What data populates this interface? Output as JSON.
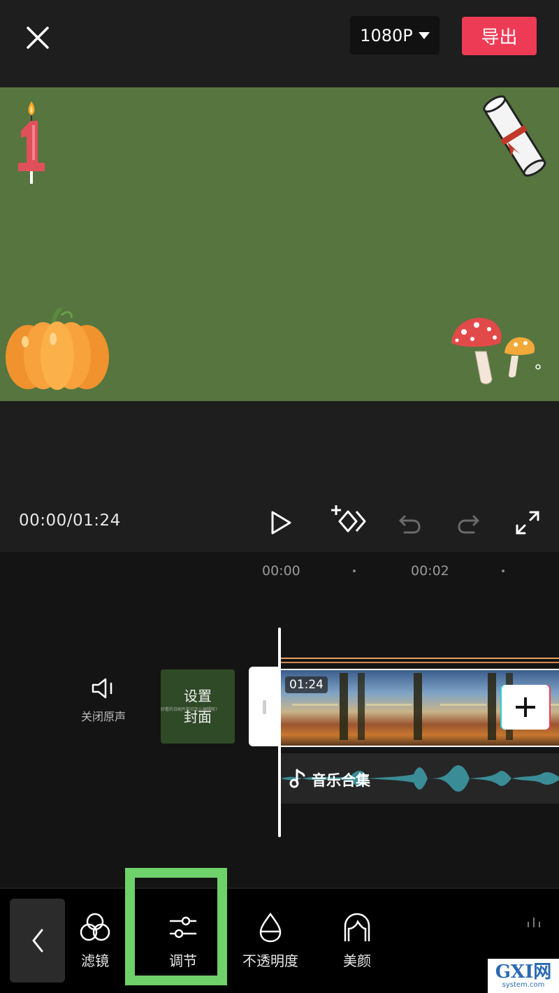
{
  "header": {
    "resolution_label": "1080P",
    "export_label": "导出",
    "accent_color": "#ee3b55"
  },
  "preview": {
    "background_color": "#56753f",
    "stickers": [
      "candle-number-1-sticker",
      "scroll-sticker",
      "pumpkin-sticker",
      "mushroom-sticker"
    ]
  },
  "playback": {
    "time_display": "00:00/01:24",
    "controls": [
      "play-icon",
      "keyframe-icon",
      "undo-icon",
      "redo-icon",
      "fullscreen-icon"
    ]
  },
  "timeline": {
    "ruler": [
      "00:00",
      "00:02"
    ],
    "mute_label": "关闭原声",
    "cover_label_line1": "设置",
    "cover_label_line2": "封面",
    "cover_tiny_text": "好看的日剧片剪切怎么编辑呢?",
    "clip_duration": "01:24",
    "audio_label": "音乐合集",
    "audio_color": "#3a8c96"
  },
  "toolbar": {
    "items": [
      {
        "label": "滤镜",
        "icon": "filter-icon"
      },
      {
        "label": "调节",
        "icon": "adjust-sliders-icon"
      },
      {
        "label": "不透明度",
        "icon": "opacity-drop-icon"
      },
      {
        "label": "美颜",
        "icon": "beauty-face-icon"
      }
    ],
    "highlight_color": "#6fd16a"
  },
  "watermark": {
    "text_top": "GXI网",
    "text_bottom": "system.com"
  }
}
